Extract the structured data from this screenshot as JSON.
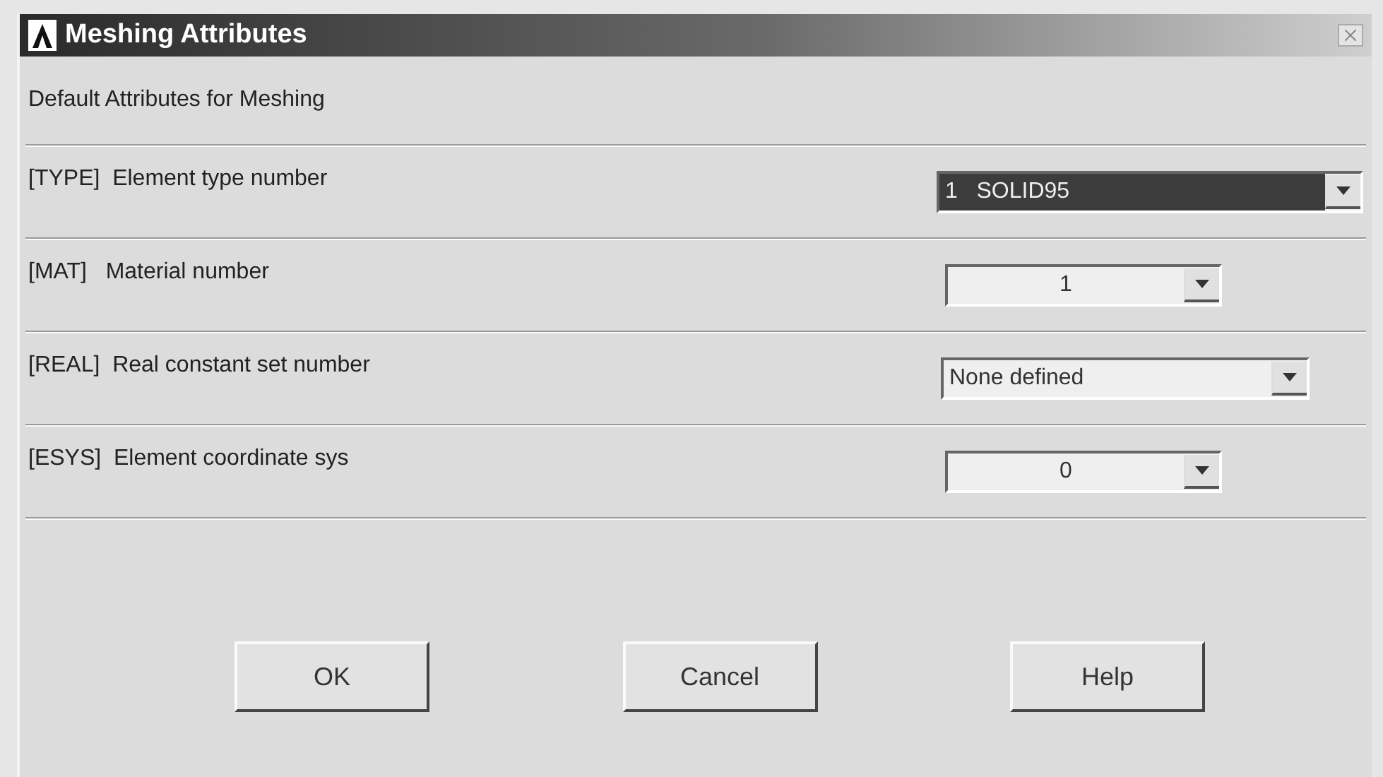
{
  "window": {
    "title": "Meshing Attributes"
  },
  "heading": "Default Attributes for Meshing",
  "fields": [
    {
      "label": "[TYPE]  Element type number",
      "value": "1   SOLID95",
      "selected": true
    },
    {
      "label": "[MAT]   Material number",
      "value": "1",
      "selected": false
    },
    {
      "label": "[REAL]  Real constant set number",
      "value": "None defined",
      "selected": false
    },
    {
      "label": "[ESYS]  Element coordinate sys",
      "value": "0",
      "selected": false
    }
  ],
  "buttons": [
    "OK",
    "Cancel",
    "Help"
  ]
}
